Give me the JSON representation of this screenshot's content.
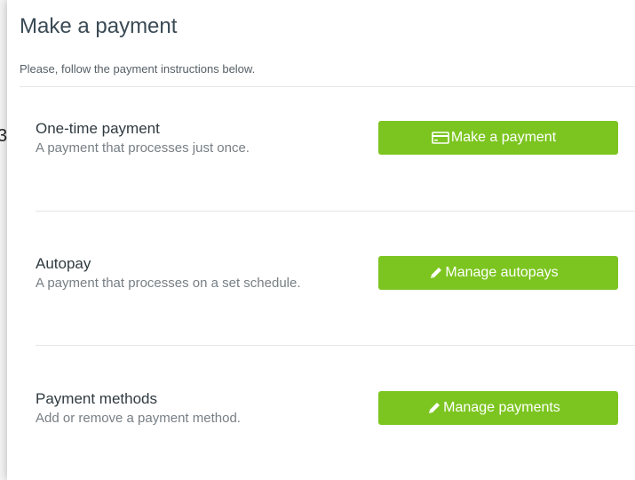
{
  "header": {
    "title": "Make a payment",
    "subtitle": "Please, follow the payment instructions below."
  },
  "edge_glyph": "3",
  "rows": [
    {
      "title": "One-time payment",
      "description": "A payment that processes just once.",
      "button_label": "Make a payment",
      "button_icon": "credit-card-icon"
    },
    {
      "title": "Autopay",
      "description": "A payment that processes on a set schedule.",
      "button_label": "Manage autopays",
      "button_icon": "pencil-icon"
    },
    {
      "title": "Payment methods",
      "description": "Add or remove a payment method.",
      "button_label": "Manage payments",
      "button_icon": "pencil-icon"
    }
  ],
  "colors": {
    "accent": "#7cc520",
    "title": "#3a4a55",
    "muted_text": "#777f85",
    "divider": "#e6e6e6"
  }
}
